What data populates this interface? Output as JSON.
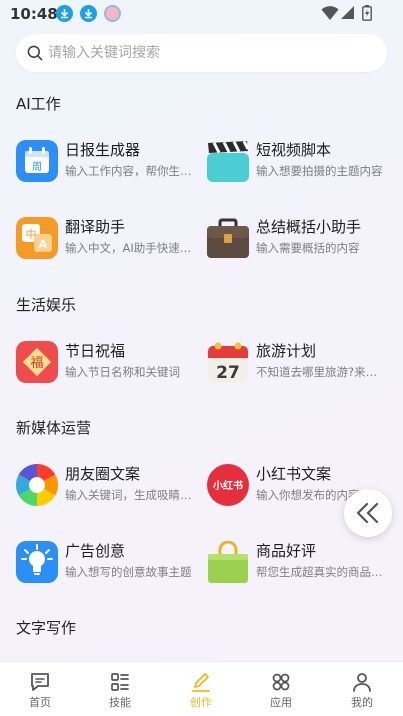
{
  "status_bar": {
    "time": "10:48"
  },
  "search": {
    "placeholder": "请输入关键词搜索"
  },
  "sections": [
    {
      "title": "AI工作",
      "items": [
        {
          "title": "日报生成器",
          "desc": "输入工作内容，帮你生成日报",
          "icon": "calendar-icon",
          "color": "#2b8ff7"
        },
        {
          "title": "短视频脚本",
          "desc": "输入想要拍摄的主题内容",
          "icon": "clapperboard-icon",
          "color": "#3fc3ef"
        },
        {
          "title": "翻译助手",
          "desc": "输入中文，AI助手快速翻译",
          "icon": "translate-icon",
          "color": "#f59a25"
        },
        {
          "title": "总结概括小助手",
          "desc": "输入需要概括的内容",
          "icon": "briefcase-icon",
          "color": "#5b4a3d"
        }
      ]
    },
    {
      "title": "生活娱乐",
      "items": [
        {
          "title": "节日祝福",
          "desc": "输入节日名称和关键词",
          "icon": "blessing-icon",
          "color": "#ef4d4d"
        },
        {
          "title": "旅游计划",
          "desc": "不知道去哪里旅游?来问我",
          "icon": "calendar-27-icon",
          "color": "#e63b3b"
        }
      ]
    },
    {
      "title": "新媒体运营",
      "items": [
        {
          "title": "朋友圈文案",
          "desc": "输入关键词，生成吸睛文案",
          "icon": "aperture-icon",
          "color": "#ff8a00"
        },
        {
          "title": "小红书文案",
          "desc": "输入你想发布的内容",
          "icon": "xiaohongshu-icon",
          "color": "#e62e3c"
        },
        {
          "title": "广告创意",
          "desc": "输入想写的创意故事主题",
          "icon": "lightbulb-icon",
          "color": "#2b8ff7"
        },
        {
          "title": "商品好评",
          "desc": "帮您生成超真实的商品好评",
          "icon": "shopping-bag-icon",
          "color": "#9bd04e"
        }
      ]
    },
    {
      "title": "文字写作",
      "items": []
    }
  ],
  "xiaohongshu_logo_text": "小红书",
  "calendar_day": "27",
  "calendar_icon_char": "周",
  "translate_icon_chars": {
    "cn": "中",
    "en": "A"
  },
  "blessing_char": "福",
  "tabs": [
    {
      "label": "首页",
      "icon": "message-icon",
      "active": false
    },
    {
      "label": "技能",
      "icon": "skills-icon",
      "active": false
    },
    {
      "label": "创作",
      "icon": "pencil-icon",
      "active": true
    },
    {
      "label": "应用",
      "icon": "apps-icon",
      "active": false
    },
    {
      "label": "我的",
      "icon": "user-icon",
      "active": false
    }
  ],
  "colors": {
    "accent": "#f0b722",
    "tab_inactive": "#666666"
  }
}
